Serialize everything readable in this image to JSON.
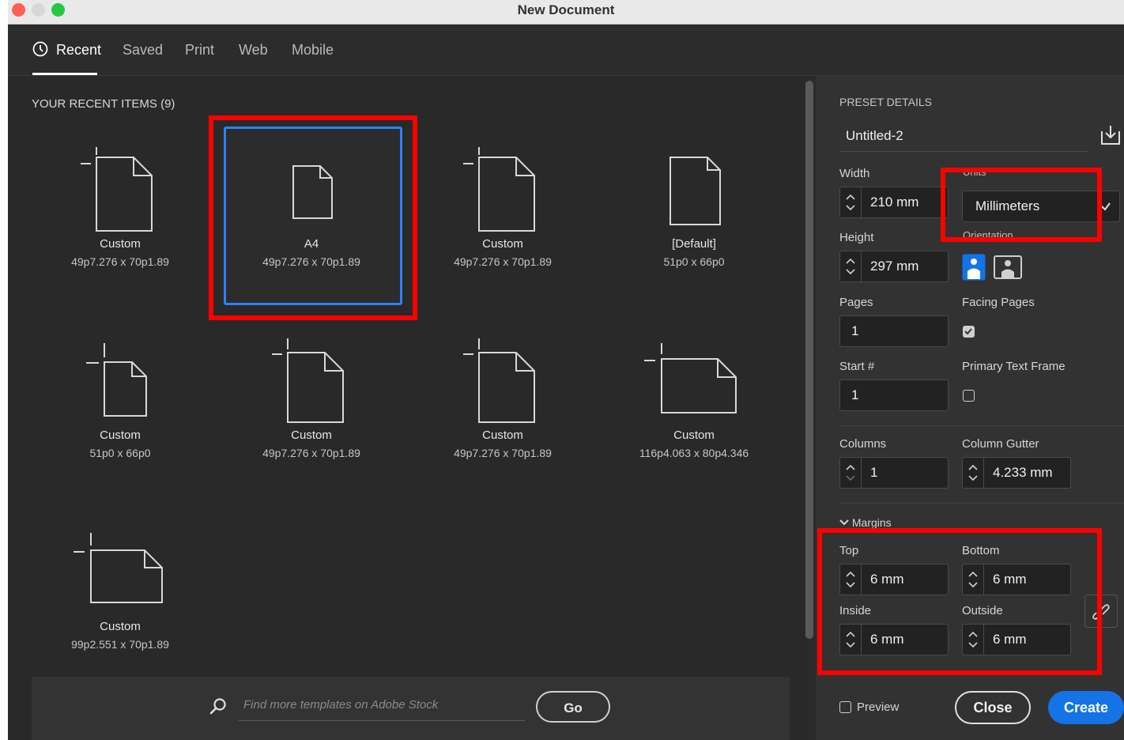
{
  "window": {
    "title": "New Document"
  },
  "tabs": [
    {
      "label": "Recent",
      "active": true,
      "icon": "clock-icon"
    },
    {
      "label": "Saved"
    },
    {
      "label": "Print"
    },
    {
      "label": "Web"
    },
    {
      "label": "Mobile"
    }
  ],
  "recent": {
    "heading": "YOUR RECENT ITEMS",
    "count": "(9)",
    "items": [
      {
        "name": "Custom",
        "size": "49p7.276 x 70p1.89"
      },
      {
        "name": "A4",
        "size": "49p7.276 x 70p1.89",
        "selected": true
      },
      {
        "name": "Custom",
        "size": "49p7.276 x 70p1.89"
      },
      {
        "name": "[Default]",
        "size": "51p0 x 66p0"
      },
      {
        "name": "Custom",
        "size": "51p0 x 66p0"
      },
      {
        "name": "Custom",
        "size": "49p7.276 x 70p1.89"
      },
      {
        "name": "Custom",
        "size": "49p7.276 x 70p1.89"
      },
      {
        "name": "Custom",
        "size": "116p4.063 x 80p4.346"
      },
      {
        "name": "Custom",
        "size": "99p2.551 x 70p1.89"
      }
    ]
  },
  "stock": {
    "placeholder": "Find more templates on Adobe Stock",
    "go_label": "Go"
  },
  "preset": {
    "heading": "PRESET DETAILS",
    "name": "Untitled-2",
    "width_label": "Width",
    "width_value": "210 mm",
    "units_label": "Units",
    "units_value": "Millimeters",
    "height_label": "Height",
    "height_value": "297 mm",
    "orientation_label": "Orientation",
    "orientation_value": "portrait",
    "pages_label": "Pages",
    "pages_value": "1",
    "facing_label": "Facing Pages",
    "facing_checked": true,
    "start_label": "Start #",
    "start_value": "1",
    "primary_frame_label": "Primary Text Frame",
    "primary_frame_checked": false,
    "columns_label": "Columns",
    "columns_value": "1",
    "gutter_label": "Column Gutter",
    "gutter_value": "4.233 mm",
    "margins_label": "Margins",
    "top_label": "Top",
    "top_value": "6 mm",
    "bottom_label": "Bottom",
    "bottom_value": "6 mm",
    "inside_label": "Inside",
    "inside_value": "6 mm",
    "outside_label": "Outside",
    "outside_value": "6 mm"
  },
  "footer": {
    "preview_label": "Preview",
    "close_label": "Close",
    "create_label": "Create"
  },
  "colors": {
    "accent": "#1473e6",
    "selection": "#2f80ff",
    "highlight": "#ff0000",
    "panel": "#323232",
    "background": "#292929"
  }
}
